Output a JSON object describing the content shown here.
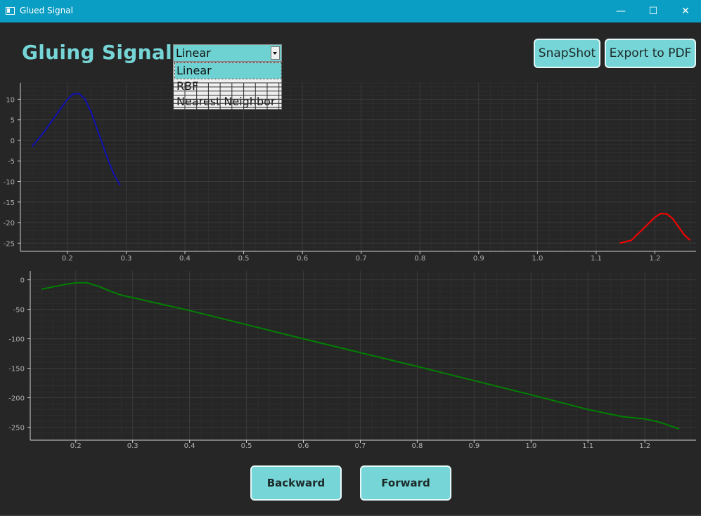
{
  "window": {
    "title": "Glued Signal",
    "controls": [
      "—",
      "☐",
      "✕"
    ]
  },
  "header": {
    "title": "Gluing Signals"
  },
  "interpolation": {
    "selected": "Linear",
    "options": [
      "Linear",
      "RBF",
      "Nearest Neighbor"
    ]
  },
  "toolbar": {
    "snapshot_label": "SnapShot",
    "export_label": "Export to PDF"
  },
  "navigation": {
    "backward_label": "Backward",
    "forward_label": "Forward"
  },
  "colors": {
    "accent": "#76d5d6",
    "background": "#262626",
    "titlebar": "#0b9ec4",
    "signal1": "#1010b4",
    "signal2": "#ff0000",
    "glued": "#008000"
  },
  "chart_data": [
    {
      "type": "line",
      "xlim": [
        0.12,
        1.27
      ],
      "ylim": [
        -27,
        14
      ],
      "x_ticks": [
        0.2,
        0.3,
        0.4,
        0.5,
        0.6,
        0.7,
        0.8,
        0.9,
        1.0,
        1.1,
        1.2
      ],
      "y_ticks": [
        10,
        5,
        0,
        -5,
        -10,
        -15,
        -20,
        -25
      ],
      "grid": true,
      "series": [
        {
          "color": "#1010b4",
          "x": [
            0.14,
            0.16,
            0.18,
            0.2,
            0.21,
            0.22,
            0.23,
            0.24,
            0.25,
            0.26,
            0.27,
            0.28,
            0.29
          ],
          "y": [
            -1.5,
            2.0,
            6.0,
            10.0,
            11.3,
            11.4,
            10.0,
            7.0,
            3.0,
            -1.0,
            -5.0,
            -8.5,
            -11.0
          ]
        },
        {
          "color": "#ff0000",
          "x": [
            1.14,
            1.16,
            1.18,
            1.2,
            1.21,
            1.22,
            1.23,
            1.24,
            1.25,
            1.26
          ],
          "y": [
            -25.0,
            -24.3,
            -21.5,
            -18.7,
            -17.8,
            -17.9,
            -19.0,
            -21.0,
            -23.0,
            -24.3
          ]
        }
      ]
    },
    {
      "type": "line",
      "xlim": [
        0.12,
        1.29
      ],
      "ylim": [
        -272,
        15
      ],
      "x_ticks": [
        0.2,
        0.3,
        0.4,
        0.5,
        0.6,
        0.7,
        0.8,
        0.9,
        1.0,
        1.1,
        1.2
      ],
      "y_ticks": [
        0,
        -50,
        -100,
        -150,
        -200,
        -250
      ],
      "grid": true,
      "series": [
        {
          "color": "#008000",
          "x": [
            0.14,
            0.16,
            0.18,
            0.2,
            0.22,
            0.24,
            0.26,
            0.28,
            0.4,
            0.6,
            0.8,
            1.0,
            1.1,
            1.16,
            1.2,
            1.22,
            1.24,
            1.26
          ],
          "y": [
            -16,
            -12,
            -8,
            -5,
            -5,
            -11,
            -19,
            -26,
            -52,
            -100,
            -147,
            -195,
            -220,
            -232,
            -236,
            -240,
            -246,
            -253
          ]
        }
      ]
    }
  ]
}
